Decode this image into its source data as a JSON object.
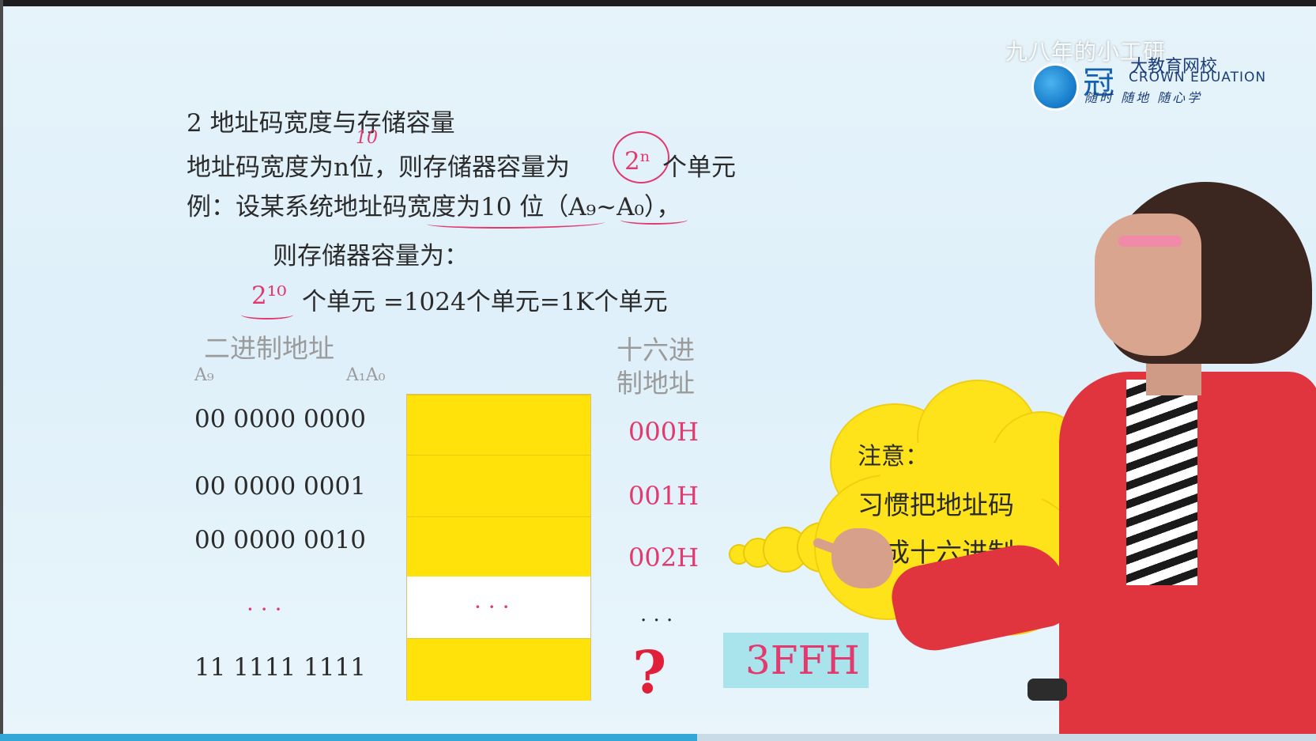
{
  "overlay": {
    "watermark": "九八年的小工研",
    "logo_main": "冠",
    "logo_cn": "大教育网校",
    "logo_en": "CROWN EDUATION",
    "logo_slogan": "随时 随地 随心学"
  },
  "slide": {
    "section_title": "2  地址码宽度与存储容量",
    "line1_pre": "地址码宽度为n位，则存储器容量为",
    "line1_formula": "2ⁿ",
    "line1_post": "个单元",
    "annotation_10": "10",
    "line2": "例：设某系统地址码宽度为10 位（A₉~A₀），",
    "line3": "则存储器容量为：",
    "line4_formula": "2¹⁰",
    "line4_rest": "个单元 =1024个单元=1K个单元",
    "binary_header": "二进制地址",
    "a9_label": "A₉",
    "a1a0_label": "A₁A₀",
    "hex_header_line1": "十六进",
    "hex_header_line2": "制地址",
    "rows": [
      {
        "binary": "00  0000  0000",
        "hex": "000H"
      },
      {
        "binary": "00  0000  0001",
        "hex": "001H"
      },
      {
        "binary": "00  0000  0010",
        "hex": "002H"
      },
      {
        "binary": "· · ·",
        "hex": "· · ·"
      },
      {
        "binary": "11  1111  1111",
        "hex": "?"
      }
    ],
    "middle_ellipsis": "· · ·",
    "answer_hex": "3FFH",
    "note_title": "注意：",
    "note_line1": "习惯把地址码",
    "note_line2": "写成十六进制"
  },
  "player": {
    "progress_fraction": 0.53
  },
  "colors": {
    "accent_pink": "#e23a6e",
    "cell_yellow": "#ffe20a",
    "answer_bg": "#a9e3ec",
    "progress": "#33a7d8"
  }
}
